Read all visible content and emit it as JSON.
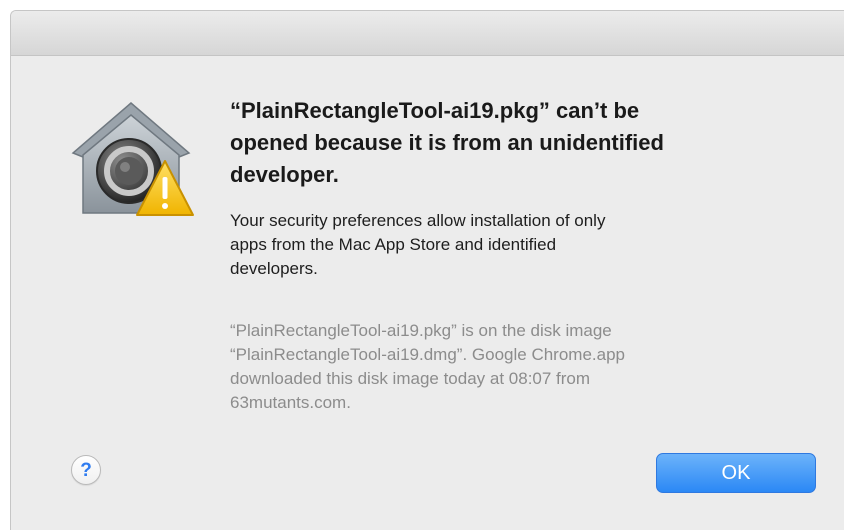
{
  "dialog": {
    "icon": "gatekeeper-security-icon",
    "warning_icon": "warning-triangle-icon",
    "headline": "“PlainRectangleTool-ai19.pkg” can’t be\nopened because it is from an unidentified\ndeveloper.",
    "body": "Your security preferences allow installation of only\napps from the Mac App Store and identified\ndevelopers.",
    "info": "“PlainRectangleTool-ai19.pkg” is on the disk image\n“PlainRectangleTool-ai19.dmg”. Google Chrome.app\ndownloaded this disk image today at 08:07 from\n63mutants.com.",
    "help_label": "?",
    "ok_label": "OK"
  },
  "colors": {
    "accent": "#2b88f5",
    "warning": "#f5c518",
    "background": "#ececec"
  }
}
